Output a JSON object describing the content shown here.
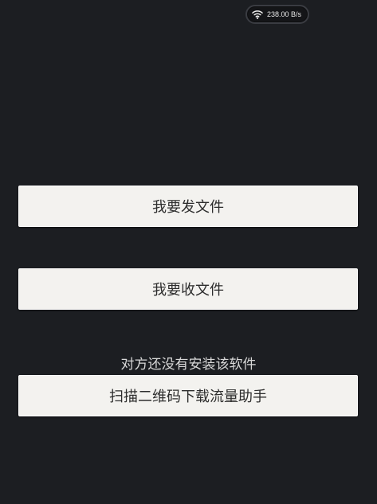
{
  "status_bar": {
    "wifi_icon": "wifi-icon",
    "speed_text": "238.00 B/s"
  },
  "actions": {
    "send_label": "我要发文件",
    "receive_label": "我要收文件",
    "hint_text": "对方还没有安装该软件",
    "scan_label": "扫描二维码下载流量助手"
  },
  "colors": {
    "background": "#1c1e22",
    "button_bg": "#f3f2ef",
    "button_text": "#2d2d2d",
    "hint_text": "#d8d8d8"
  }
}
